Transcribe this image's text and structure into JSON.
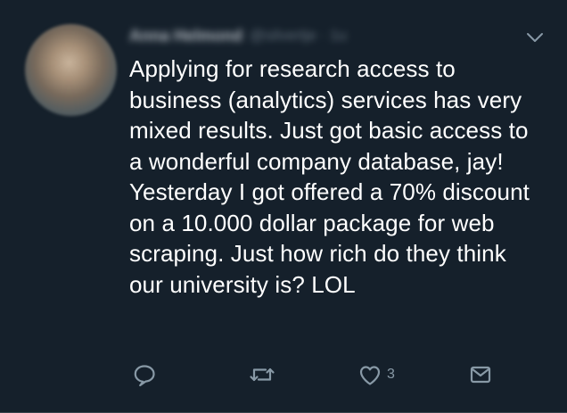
{
  "tweet": {
    "author_name": "Anna Helmond",
    "author_handle": "@silvertje · 1u",
    "text": "Applying for research access to business (analytics) services has very mixed results. Just got basic access to a wonderful company database, jay! Yesterday I got offered a 70% discount on a 10.000 dollar package for web scraping. Just how rich do they think our university is? LOL",
    "like_count": "3"
  },
  "icons": {
    "menu": "chevron-down-icon",
    "reply": "reply-icon",
    "retweet": "retweet-icon",
    "like": "heart-icon",
    "message": "message-icon"
  },
  "colors": {
    "background": "#15202b",
    "text": "#ffffff",
    "muted": "#8899a6"
  }
}
